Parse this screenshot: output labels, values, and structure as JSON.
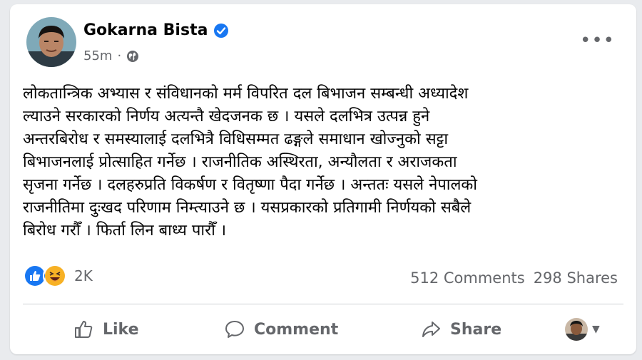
{
  "post": {
    "author": "Gokarna Bista",
    "time": "55m",
    "separator": "·",
    "text": "लोकतान्त्रिक अभ्यास र संविधानको मर्म विपरित दल बिभाजन सम्बन्धी अध्यादेश\nल्याउने सरकारको निर्णय अत्यन्तै खेदजनक छ । यसले दलभित्र उत्पन्न हुने\nअन्तरबिरोध र समस्यालाई दलभित्रै विधिसम्मत ढङ्गले समाधान खोज्नुको सट्टा\nबिभाजनलाई प्रोत्साहित गर्नेछ । राजनीतिक अस्थिरता, अन्यौलता र अराजकता\nसृजना गर्नेछ । दलहरुप्रति विकर्षण र वितृष्णा पैदा गर्नेछ । अन्ततः यसले नेपालको\nराजनीतिमा दुःखद परिणाम निम्त्याउने छ । यसप्रकारको प्रतिगामी निर्णयको सबैले\nबिरोध गरौँ । फिर्ता लिन बाध्य पारौँ ।",
    "icons": {
      "verified": "verified-badge-icon",
      "audience": "globe-icon",
      "menu": "more-options-icon"
    }
  },
  "engagement": {
    "reaction_count": "2K",
    "reactions": [
      "like-reaction-icon",
      "haha-reaction-icon"
    ],
    "comments": "512 Comments",
    "shares": "298 Shares"
  },
  "actions": {
    "like": "Like",
    "comment": "Comment",
    "share": "Share"
  },
  "colors": {
    "verified_blue": "#1877f2",
    "secondary_text": "#65676b",
    "haha_yellow": "#f7b125"
  }
}
